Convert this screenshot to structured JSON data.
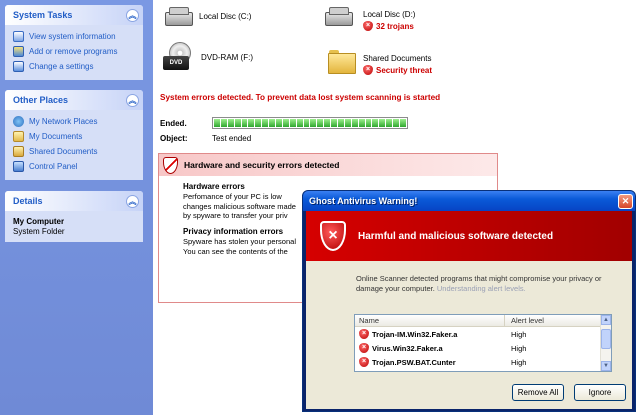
{
  "sidebar": {
    "system_tasks": {
      "title": "System Tasks",
      "items": [
        {
          "label": "View system information",
          "icon": "info-icon"
        },
        {
          "label": "Add or remove programs",
          "icon": "add-remove-icon"
        },
        {
          "label": "Change a settings",
          "icon": "settings-icon"
        }
      ]
    },
    "other_places": {
      "title": "Other Places",
      "items": [
        {
          "label": "My Network Places",
          "icon": "network-icon"
        },
        {
          "label": "My Documents",
          "icon": "documents-icon"
        },
        {
          "label": "Shared Documents",
          "icon": "shared-folder-icon"
        },
        {
          "label": "Control Panel",
          "icon": "control-panel-icon"
        }
      ]
    },
    "details": {
      "title": "Details",
      "name": "My Computer",
      "sub": "System Folder"
    },
    "collapse_glyph": "︽"
  },
  "drives": {
    "c": {
      "label": "Local Disc (C:)"
    },
    "d": {
      "label": "Local Disc (D:)",
      "status": "32 trojans"
    },
    "f": {
      "label": "DVD-RAM (F:)",
      "badge": "DVD"
    },
    "shared": {
      "label": "Shared Documents",
      "status": "Security threat"
    }
  },
  "shield_glyph": "×",
  "system_error": "System errors detected. To prevent data lost system scanning is started",
  "scan": {
    "ended_label": "Ended.",
    "object_label": "Object:",
    "object_value": "Test ended",
    "progress_fraction": 1.0
  },
  "alert_panel": {
    "title": "Hardware and security errors detected",
    "hardware": {
      "title": "Hardware errors",
      "lines": [
        "Perfomance of your PC is low",
        "changes malicious software made",
        "by spyware to transfer your priv"
      ]
    },
    "privacy": {
      "title": "Privacy information errors",
      "lines": [
        "Spyware has stolen your personal",
        "You can see the contents of the"
      ]
    }
  },
  "modal": {
    "title": "Ghost Antivirus Warning!",
    "close_glyph": "✕",
    "banner_title": "Harmful and malicious software detected",
    "desc_main": "Online Scanner detected programs that might compromise your privacy or damage your computer.",
    "desc_link": "Understanding alert levels.",
    "columns": {
      "name": "Name",
      "level": "Alert level"
    },
    "rows": [
      {
        "name": "Trojan-IM.Win32.Faker.a",
        "level": "High"
      },
      {
        "name": "Virus.Win32.Faker.a",
        "level": "High"
      },
      {
        "name": "Trojan.PSW.BAT.Cunter",
        "level": "High"
      }
    ],
    "scroll_up_glyph": "▲",
    "scroll_down_glyph": "▼",
    "remove_all_label": "Remove All",
    "ignore_label": "Ignore"
  }
}
